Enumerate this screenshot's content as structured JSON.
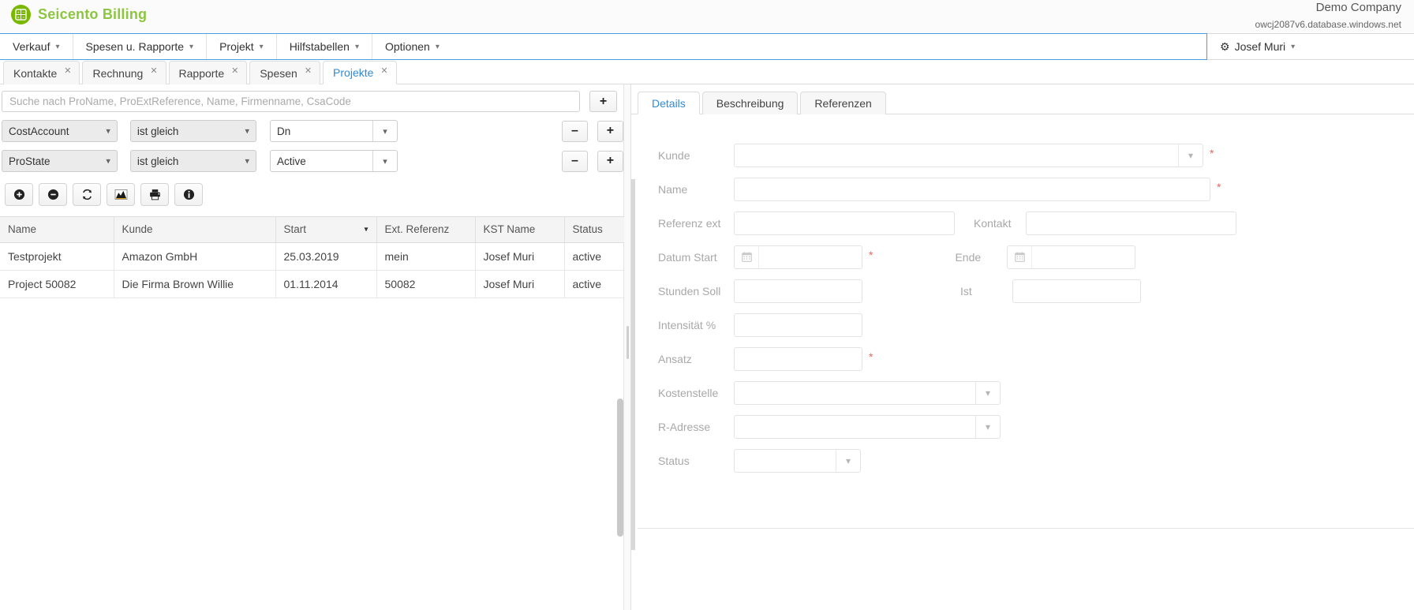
{
  "app": {
    "brand": "Seicento Billing",
    "logo_icon": "calculator-icon",
    "company": "Demo Company",
    "db_host": "owcj2087v6.database.windows.net",
    "user": "Josef Muri",
    "user_icon": "gear-icon",
    "caret_icon": "chevron-down-icon"
  },
  "menu": {
    "items": [
      {
        "label": "Verkauf"
      },
      {
        "label": "Spesen u. Rapporte"
      },
      {
        "label": "Projekt"
      },
      {
        "label": "Hilfstabellen"
      },
      {
        "label": "Optionen"
      }
    ]
  },
  "tabs": {
    "close_icon": "close-icon",
    "items": [
      {
        "label": "Kontakte",
        "active": false
      },
      {
        "label": "Rechnung",
        "active": false
      },
      {
        "label": "Rapporte",
        "active": false
      },
      {
        "label": "Spesen",
        "active": false
      },
      {
        "label": "Projekte",
        "active": true
      }
    ]
  },
  "search": {
    "value": "",
    "placeholder": "Suche nach ProName, ProExtReference, Name, Firmenname, CsaCode",
    "add_label": "+"
  },
  "filters": {
    "remove_label": "–",
    "add_label": "+",
    "rows": [
      {
        "field": "CostAccount",
        "operator": "ist gleich",
        "value": "Dn"
      },
      {
        "field": "ProState",
        "operator": "ist gleich",
        "value": "Active"
      }
    ]
  },
  "toolbar": {
    "buttons": [
      {
        "icon": "plus-circle-icon",
        "name": "add-record-button"
      },
      {
        "icon": "minus-circle-icon",
        "name": "delete-record-button"
      },
      {
        "icon": "refresh-icon",
        "name": "refresh-button"
      },
      {
        "icon": "chart-icon",
        "name": "chart-button"
      },
      {
        "icon": "print-icon",
        "name": "print-button"
      },
      {
        "icon": "info-icon",
        "name": "info-button"
      }
    ]
  },
  "table": {
    "sort_icon": "sort-descending-icon",
    "sorted_column": "Start",
    "columns": [
      "Name",
      "Kunde",
      "Start",
      "Ext. Referenz",
      "KST Name",
      "Status"
    ],
    "rows": [
      {
        "name": "Testprojekt",
        "kunde": "Amazon GmbH",
        "start": "25.03.2019",
        "ext_referenz": "mein",
        "kst_name": "Josef Muri",
        "status": "active"
      },
      {
        "name": "Project 50082",
        "kunde": "Die Firma Brown Willie",
        "start": "01.11.2014",
        "ext_referenz": "50082",
        "kst_name": "Josef Muri",
        "status": "active"
      }
    ]
  },
  "details": {
    "tabs": [
      {
        "label": "Details",
        "active": true
      },
      {
        "label": "Beschreibung",
        "active": false
      },
      {
        "label": "Referenzen",
        "active": false
      }
    ],
    "required_marker": "*",
    "calendar_icon": "calendar-icon",
    "chevron_icon": "chevron-down-icon",
    "fields": {
      "kunde": {
        "label": "Kunde",
        "value": "",
        "required": true
      },
      "name": {
        "label": "Name",
        "value": "",
        "required": true
      },
      "referenz_ext": {
        "label": "Referenz ext",
        "value": ""
      },
      "kontakt": {
        "label": "Kontakt",
        "value": ""
      },
      "datum_start": {
        "label": "Datum Start",
        "value": "",
        "required": true
      },
      "ende": {
        "label": "Ende",
        "value": ""
      },
      "stunden_soll": {
        "label": "Stunden Soll",
        "value": ""
      },
      "ist": {
        "label": "Ist",
        "value": ""
      },
      "intensitaet": {
        "label": "Intensität %",
        "value": ""
      },
      "ansatz": {
        "label": "Ansatz",
        "value": "",
        "required": true
      },
      "kostenstelle": {
        "label": "Kostenstelle",
        "value": ""
      },
      "r_adresse": {
        "label": "R-Adresse",
        "value": ""
      },
      "status": {
        "label": "Status",
        "value": ""
      }
    }
  },
  "colors": {
    "brand_green": "#8cc63e",
    "accent_blue": "#2e8bd8",
    "required_red": "#e8685a",
    "focus_border": "#4a9fe0"
  }
}
